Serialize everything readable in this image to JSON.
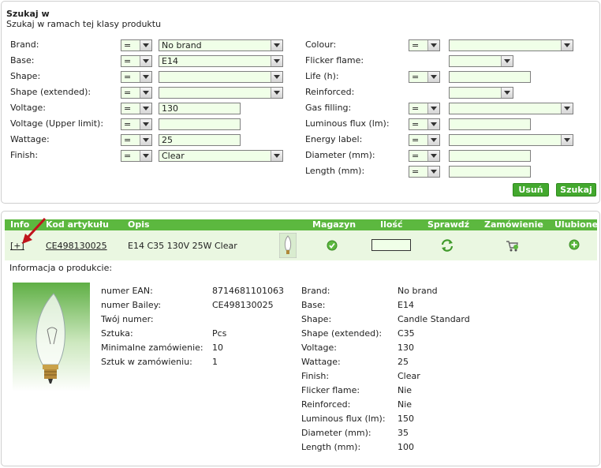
{
  "search": {
    "title": "Szukaj w",
    "subtitle": "Szukaj w ramach tej klasy produktu",
    "left": [
      {
        "label": "Brand:",
        "op": "=",
        "value": "No brand",
        "kind": "select"
      },
      {
        "label": "Base:",
        "op": "=",
        "value": "E14",
        "kind": "select"
      },
      {
        "label": "Shape:",
        "op": "=",
        "value": "",
        "kind": "select"
      },
      {
        "label": "Shape (extended):",
        "op": "=",
        "value": "",
        "kind": "select"
      },
      {
        "label": "Voltage:",
        "op": "=",
        "value": "130",
        "kind": "input"
      },
      {
        "label": "Voltage (Upper limit):",
        "op": "=",
        "value": "",
        "kind": "input"
      },
      {
        "label": "Wattage:",
        "op": "=",
        "value": "25",
        "kind": "input"
      },
      {
        "label": "Finish:",
        "op": "=",
        "value": "Clear",
        "kind": "select"
      }
    ],
    "right": [
      {
        "label": "Colour:",
        "op": "=",
        "value": "",
        "kind": "select"
      },
      {
        "label": "Flicker flame:",
        "op": null,
        "value": "",
        "kind": "smallselect"
      },
      {
        "label": "Life (h):",
        "op": "=",
        "value": "",
        "kind": "input"
      },
      {
        "label": "Reinforced:",
        "op": null,
        "value": "",
        "kind": "smallselect"
      },
      {
        "label": "Gas filling:",
        "op": "=",
        "value": "",
        "kind": "select"
      },
      {
        "label": "Luminous flux (lm):",
        "op": "=",
        "value": "",
        "kind": "input"
      },
      {
        "label": "Energy label:",
        "op": "=",
        "value": "",
        "kind": "select"
      },
      {
        "label": "Diameter (mm):",
        "op": "=",
        "value": "",
        "kind": "input"
      },
      {
        "label": "Length (mm):",
        "op": "=",
        "value": "",
        "kind": "input"
      }
    ],
    "remove_label": "Usuń",
    "search_label": "Szukaj"
  },
  "results": {
    "headers": {
      "info": "Info",
      "code": "Kod artykułu",
      "desc": "Opis",
      "stock": "Magazyn",
      "qty": "Ilość",
      "check": "Sprawdź",
      "order": "Zamówienie",
      "fav": "Ulubione"
    },
    "row": {
      "expand": "[+]",
      "code": "CE498130025",
      "desc": "E14 C35 130V 25W Clear",
      "qty": ""
    },
    "info_title": "Informacja o produkcie:",
    "details_left": [
      {
        "k": "numer EAN:",
        "v": "8714681101063"
      },
      {
        "k": "numer Bailey:",
        "v": "CE498130025"
      },
      {
        "k": "Twój numer:",
        "v": ""
      },
      {
        "k": "Sztuka:",
        "v": "Pcs"
      },
      {
        "k": "Minimalne zamówienie:",
        "v": "10"
      },
      {
        "k": "Sztuk w zamówieniu:",
        "v": "1"
      }
    ],
    "details_right": [
      {
        "k": "Brand:",
        "v": "No brand"
      },
      {
        "k": "Base:",
        "v": "E14"
      },
      {
        "k": "Shape:",
        "v": "Candle Standard"
      },
      {
        "k": "Shape (extended):",
        "v": "C35"
      },
      {
        "k": "Voltage:",
        "v": "130"
      },
      {
        "k": "Wattage:",
        "v": "25"
      },
      {
        "k": "Finish:",
        "v": "Clear"
      },
      {
        "k": "Flicker flame:",
        "v": "Nie"
      },
      {
        "k": "Reinforced:",
        "v": "Nie"
      },
      {
        "k": "Luminous flux (lm):",
        "v": "150"
      },
      {
        "k": "Diameter (mm):",
        "v": "35"
      },
      {
        "k": "Length (mm):",
        "v": "100"
      }
    ]
  },
  "colors": {
    "accent": "#5cb83f",
    "row_bg": "#eaf7e1",
    "field_bg": "#f0ffe8",
    "annotation_arrow": "#c0141c"
  },
  "icons": {
    "stock": "checkmark-circle-icon",
    "check": "refresh-arrows-icon",
    "order": "cart-add-icon",
    "fav": "plus-circle-icon",
    "thumb": "bulb-thumbnail-icon"
  }
}
